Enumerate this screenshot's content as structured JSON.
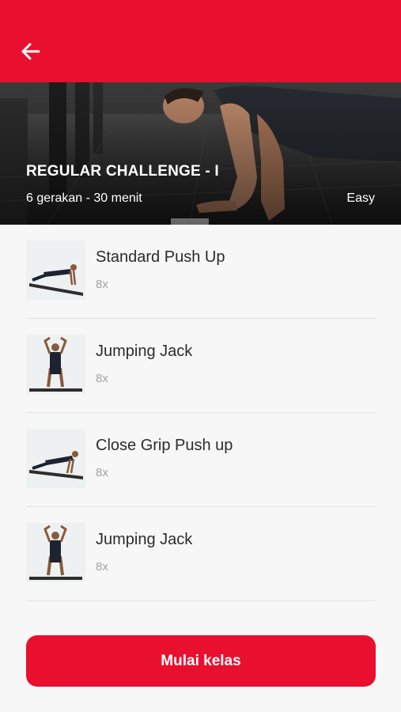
{
  "header": {
    "back_icon": "arrow-left-icon",
    "accent_color": "#e8102e"
  },
  "program": {
    "title": "REGULAR CHALLENGE - I",
    "meta": "6 gerakan - 30 menit",
    "level": "Easy"
  },
  "exercises": [
    {
      "name": "Standard Push Up",
      "reps": "8x"
    },
    {
      "name": "Jumping Jack",
      "reps": "8x"
    },
    {
      "name": "Close Grip Push up",
      "reps": "8x"
    },
    {
      "name": "Jumping Jack",
      "reps": "8x"
    }
  ],
  "footer": {
    "start_label": "Mulai kelas"
  }
}
